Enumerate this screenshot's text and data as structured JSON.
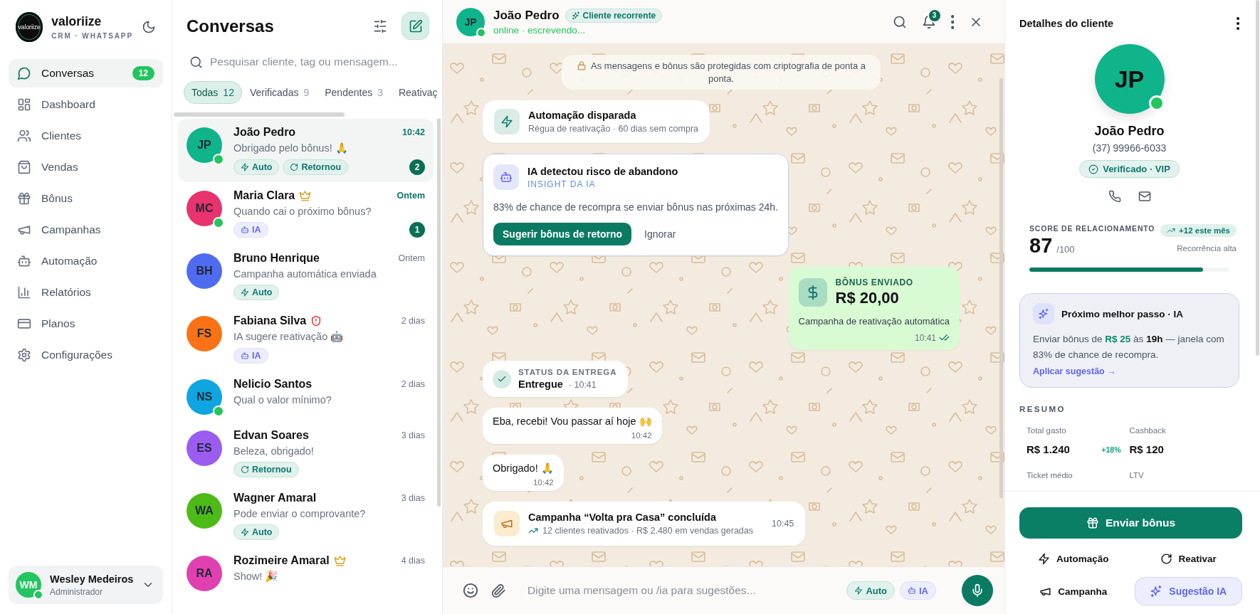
{
  "sidebar": {
    "brand": {
      "logo_text": "valoriize",
      "name": "valoriize",
      "subtitle": "CRM · WHATSAPP"
    },
    "nav": [
      {
        "label": "Conversas",
        "selected": true,
        "badge": "12"
      },
      {
        "label": "Dashboard",
        "selected": false
      },
      {
        "label": "Clientes",
        "selected": false
      },
      {
        "label": "Vendas",
        "selected": false
      },
      {
        "label": "Bônus",
        "selected": false
      },
      {
        "label": "Campanhas",
        "selected": false
      },
      {
        "label": "Automação",
        "selected": false
      },
      {
        "label": "Relatórios",
        "selected": false
      },
      {
        "label": "Planos",
        "selected": false
      },
      {
        "label": "Configurações",
        "selected": false
      }
    ],
    "user": {
      "initials": "WM",
      "name": "Wesley Medeiros",
      "role": "Administrador",
      "online": true
    }
  },
  "conversation_list": {
    "title": "Conversas",
    "search": {
      "placeholder": "Pesquisar cliente, tag ou mensagem..."
    },
    "filters": [
      {
        "label": "Todas",
        "count": "12",
        "selected": true
      },
      {
        "label": "Verificadas",
        "count": "9",
        "selected": false
      },
      {
        "label": "Pendentes",
        "count": "3",
        "selected": false
      },
      {
        "label": "Reativaç",
        "selected": false
      }
    ],
    "conversations": [
      {
        "initials": "JP",
        "color": "#10b48a",
        "name": "João Pedro",
        "vip": false,
        "at_risk": false,
        "time": "10:42",
        "preview": "Obrigado pelo bônus! 🙏",
        "tags": [
          {
            "kind": "auto",
            "label": "Auto"
          },
          {
            "kind": "returned",
            "label": "Retornou"
          }
        ],
        "unread": "2",
        "online": true,
        "selected": true
      },
      {
        "initials": "MC",
        "color": "#e8336f",
        "name": "Maria Clara",
        "vip": true,
        "at_risk": false,
        "time": "Ontem",
        "preview": "Quando cai o próximo bônus?",
        "tags": [
          {
            "kind": "ia",
            "label": "IA"
          }
        ],
        "unread": "1",
        "online": true,
        "selected": false
      },
      {
        "initials": "BH",
        "color": "#4f6cf0",
        "name": "Bruno Henrique",
        "vip": false,
        "at_risk": false,
        "time": "Ontem",
        "preview": "Campanha automática enviada",
        "tags": [
          {
            "kind": "auto",
            "label": "Auto"
          }
        ],
        "online": false,
        "selected": false
      },
      {
        "initials": "FS",
        "color": "#f97316",
        "name": "Fabiana Silva",
        "vip": false,
        "at_risk": true,
        "time": "2 dias",
        "preview": "IA sugere reativação 🤖",
        "tags": [
          {
            "kind": "ia",
            "label": "IA"
          }
        ],
        "online": false,
        "selected": false
      },
      {
        "initials": "NS",
        "color": "#0ea5e0",
        "name": "Nelicio Santos",
        "vip": false,
        "at_risk": false,
        "time": "2 dias",
        "preview": "Qual o valor mínimo?",
        "online": true,
        "selected": false
      },
      {
        "initials": "ES",
        "color": "#9b5cf0",
        "name": "Edvan Soares",
        "vip": false,
        "at_risk": false,
        "time": "3 dias",
        "preview": "Beleza, obrigado!",
        "tags": [
          {
            "kind": "returned",
            "label": "Retornou"
          }
        ],
        "online": false,
        "selected": false
      },
      {
        "initials": "WA",
        "color": "#4cbb17",
        "name": "Wagner Amaral",
        "vip": false,
        "at_risk": false,
        "time": "3 dias",
        "preview": "Pode enviar o comprovante?",
        "tags": [
          {
            "kind": "auto",
            "label": "Auto"
          }
        ],
        "online": false,
        "selected": false
      },
      {
        "initials": "RA",
        "color": "#e040b0",
        "name": "Rozimeire Amaral",
        "vip": true,
        "at_risk": false,
        "time": "4 dias",
        "preview": "Show! 🎉",
        "online": false,
        "selected": false
      }
    ]
  },
  "chat": {
    "contact": {
      "initials": "JP",
      "name": "João Pedro",
      "tag": "Cliente recorrente",
      "status": "online · escrevendo...",
      "online": true
    },
    "notifications": "3",
    "messages": [
      {
        "kind": "notice",
        "text": "As mensagens e bônus são protegidas com criptografia de ponta a ponta."
      },
      {
        "kind": "event",
        "title": "Automação disparada",
        "subtitle": "Régua de reativação · 60 dias sem compra"
      },
      {
        "kind": "insight",
        "title": "IA detectou risco de abandono",
        "label": "INSIGHT DA IA",
        "text": "83% de chance de recompra se enviar bônus nas próximas 24h.",
        "actions": [
          {
            "kind": "primary",
            "label": "Sugerir bônus de retorno"
          },
          {
            "kind": "plain",
            "label": "Ignorar"
          }
        ]
      },
      {
        "kind": "bonus",
        "label": "BÔNUS ENVIADO",
        "amount": "R$ 20,00",
        "text": "Campanha de reativação automática",
        "time": "10:41",
        "read": true
      },
      {
        "kind": "status",
        "label": "STATUS DA ENTREGA",
        "status": "Entregue",
        "time": "· 10:41"
      },
      {
        "kind": "incoming",
        "text": "Eba, recebi! Vou passar aí hoje 🙌",
        "time": "10:42"
      },
      {
        "kind": "incoming",
        "text": "Obrigado! 🙏",
        "time": "10:42"
      },
      {
        "kind": "campaign",
        "title": "Campanha “Volta pra Casa” concluída",
        "subtitle": "12 clientes reativados · R$ 2.480 em vendas geradas",
        "time": "10:45"
      }
    ],
    "composer": {
      "placeholder": "Digite uma mensagem ou /ia para sugestões...",
      "chips": [
        {
          "kind": "auto",
          "label": "Auto"
        },
        {
          "kind": "ia",
          "label": "IA"
        }
      ]
    }
  },
  "client_panel": {
    "title": "Detalhes do cliente",
    "initials": "JP",
    "color": "#10b48a",
    "online": true,
    "name": "João Pedro",
    "phone": "(37) 99966-6033",
    "badge": "Verificado · VIP",
    "score": {
      "label": "SCORE DE RELACIONAMENTO",
      "value": "87",
      "max": "/100",
      "trend": "+12 este mês",
      "note": "Recorrência alta",
      "level": 0.87
    },
    "next_step": {
      "title": "Próximo melhor passo · IA",
      "text": "Enviar bônus de **R$ 25** às **19h** — janela com 83% de chance de recompra.",
      "link": "Aplicar sugestão →"
    },
    "summary": {
      "title": "RESUMO",
      "stats": [
        {
          "label": "Total gasto",
          "value": "R$ 1.240",
          "change": "+18%"
        },
        {
          "label": "Cashback",
          "value": "R$ 120"
        },
        {
          "label": "Ticket médio"
        },
        {
          "label": "LTV"
        }
      ]
    },
    "actions": [
      {
        "kind": "primary",
        "label": "Enviar bônus"
      },
      {
        "kind": "plain",
        "label": "Automação"
      },
      {
        "kind": "plain",
        "label": "Reativar"
      },
      {
        "kind": "plain",
        "label": "Campanha"
      },
      {
        "kind": "ai",
        "label": "Sugestão IA"
      }
    ]
  }
}
